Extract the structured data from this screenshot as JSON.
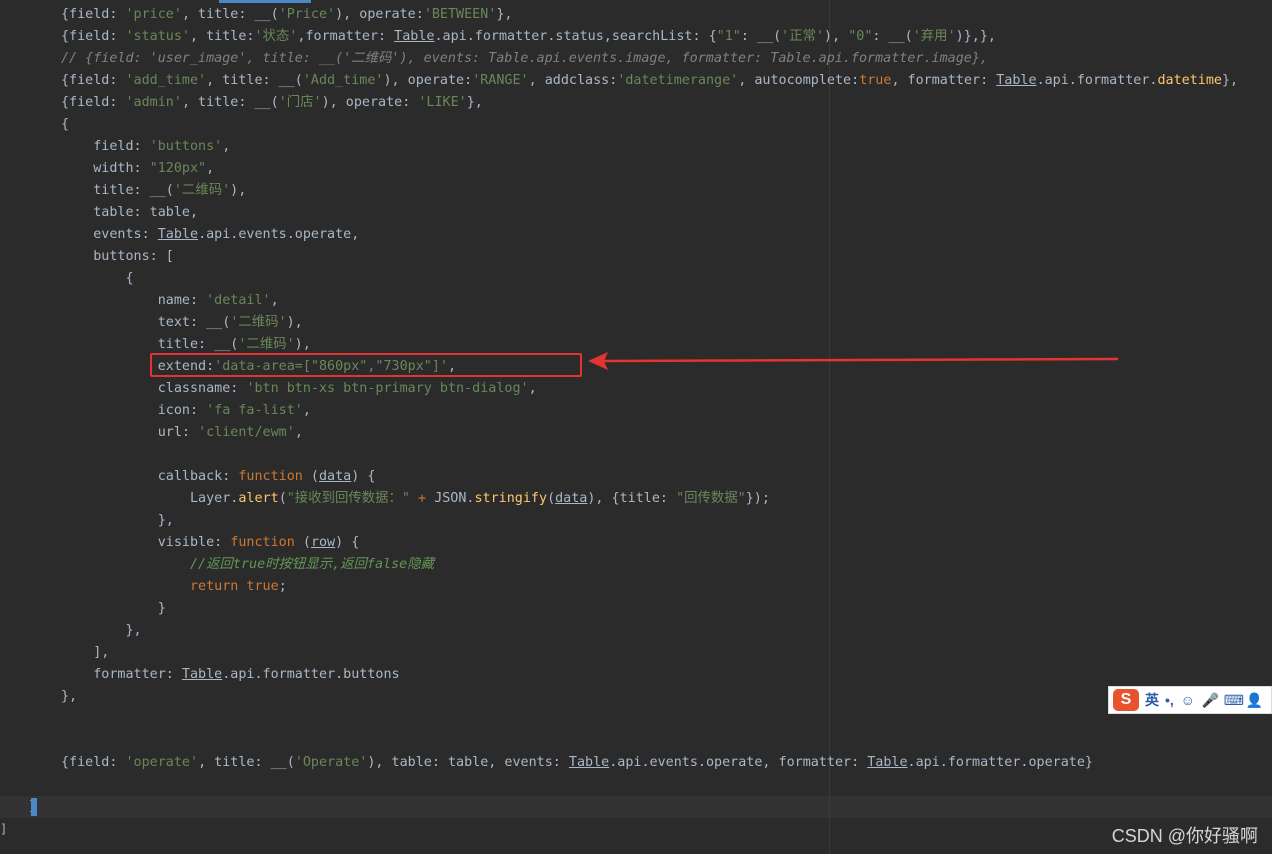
{
  "editor": {
    "lines": [
      [
        {
          "t": "{field: ",
          "c": "p0"
        },
        {
          "t": "'price'",
          "c": "s"
        },
        {
          "t": ", title: __(",
          "c": "p0"
        },
        {
          "t": "'Price'",
          "c": "s"
        },
        {
          "t": "), operate:",
          "c": "p0"
        },
        {
          "t": "'BETWEEN'",
          "c": "s"
        },
        {
          "t": "},",
          "c": "p0"
        }
      ],
      [
        {
          "t": "{field: ",
          "c": "p0"
        },
        {
          "t": "'status'",
          "c": "s"
        },
        {
          "t": ", title:",
          "c": "p0"
        },
        {
          "t": "'状态'",
          "c": "s"
        },
        {
          "t": ",formatter: ",
          "c": "p0"
        },
        {
          "t": "Table",
          "c": "u"
        },
        {
          "t": ".api.formatter.status,searchList: {",
          "c": "p0"
        },
        {
          "t": "\"1\"",
          "c": "s"
        },
        {
          "t": ": __(",
          "c": "p0"
        },
        {
          "t": "'正常'",
          "c": "s"
        },
        {
          "t": "), ",
          "c": "p0"
        },
        {
          "t": "\"0\"",
          "c": "s"
        },
        {
          "t": ": __(",
          "c": "p0"
        },
        {
          "t": "'弃用'",
          "c": "s"
        },
        {
          "t": ")},},",
          "c": "p0"
        }
      ],
      [
        {
          "t": "// {field: 'user_image', title: __('二维码'), events: Table.api.events.image, formatter: Table.api.formatter.image},",
          "c": "cm"
        }
      ],
      [
        {
          "t": "{field: ",
          "c": "p0"
        },
        {
          "t": "'add_time'",
          "c": "s"
        },
        {
          "t": ", title: __(",
          "c": "p0"
        },
        {
          "t": "'Add_time'",
          "c": "s"
        },
        {
          "t": "), operate:",
          "c": "p0"
        },
        {
          "t": "'RANGE'",
          "c": "s"
        },
        {
          "t": ", addclass:",
          "c": "p0"
        },
        {
          "t": "'datetimerange'",
          "c": "s"
        },
        {
          "t": ", autocomplete:",
          "c": "p0"
        },
        {
          "t": "true",
          "c": "k"
        },
        {
          "t": ", formatter: ",
          "c": "p0"
        },
        {
          "t": "Table",
          "c": "u"
        },
        {
          "t": ".api.formatter.",
          "c": "p0"
        },
        {
          "t": "datetime",
          "c": "f"
        },
        {
          "t": "},",
          "c": "p0"
        }
      ],
      [
        {
          "t": "{field: ",
          "c": "p0"
        },
        {
          "t": "'admin'",
          "c": "s"
        },
        {
          "t": ", title: __(",
          "c": "p0"
        },
        {
          "t": "'门店'",
          "c": "s"
        },
        {
          "t": "), operate: ",
          "c": "p0"
        },
        {
          "t": "'LIKE'",
          "c": "s"
        },
        {
          "t": "},",
          "c": "p0"
        }
      ],
      [
        {
          "t": "{",
          "c": "p0"
        }
      ],
      [
        {
          "t": "    field: ",
          "c": "p0"
        },
        {
          "t": "'buttons'",
          "c": "s"
        },
        {
          "t": ",",
          "c": "p0"
        }
      ],
      [
        {
          "t": "    width: ",
          "c": "p0"
        },
        {
          "t": "\"120px\"",
          "c": "s"
        },
        {
          "t": ",",
          "c": "p0"
        }
      ],
      [
        {
          "t": "    title: __(",
          "c": "p0"
        },
        {
          "t": "'二维码'",
          "c": "s"
        },
        {
          "t": "),",
          "c": "p0"
        }
      ],
      [
        {
          "t": "    table: table,",
          "c": "p0"
        }
      ],
      [
        {
          "t": "    events: ",
          "c": "p0"
        },
        {
          "t": "Table",
          "c": "u"
        },
        {
          "t": ".api.events.operate,",
          "c": "p0"
        }
      ],
      [
        {
          "t": "    buttons: [",
          "c": "p0"
        }
      ],
      [
        {
          "t": "        {",
          "c": "p0"
        }
      ],
      [
        {
          "t": "            name: ",
          "c": "p0"
        },
        {
          "t": "'detail'",
          "c": "s"
        },
        {
          "t": ",",
          "c": "p0"
        }
      ],
      [
        {
          "t": "            text: __(",
          "c": "p0"
        },
        {
          "t": "'二维码'",
          "c": "s"
        },
        {
          "t": "),",
          "c": "p0"
        }
      ],
      [
        {
          "t": "            title: __(",
          "c": "p0"
        },
        {
          "t": "'二维码'",
          "c": "s"
        },
        {
          "t": "),",
          "c": "p0"
        }
      ],
      [
        {
          "t": "            extend:",
          "c": "p0"
        },
        {
          "t": "'data-area=[\"860px\",\"730px\"]'",
          "c": "s"
        },
        {
          "t": ",",
          "c": "p0"
        }
      ],
      [
        {
          "t": "            classname: ",
          "c": "p0"
        },
        {
          "t": "'btn btn-xs btn-primary btn-dialog'",
          "c": "s"
        },
        {
          "t": ",",
          "c": "p0"
        }
      ],
      [
        {
          "t": "            icon: ",
          "c": "p0"
        },
        {
          "t": "'fa fa-list'",
          "c": "s"
        },
        {
          "t": ",",
          "c": "p0"
        }
      ],
      [
        {
          "t": "            url: ",
          "c": "p0"
        },
        {
          "t": "'client/ewm'",
          "c": "s"
        },
        {
          "t": ",",
          "c": "p0"
        }
      ],
      [
        {
          "t": "",
          "c": "p0"
        }
      ],
      [
        {
          "t": "            callback: ",
          "c": "p0"
        },
        {
          "t": "function",
          "c": "k"
        },
        {
          "t": " (",
          "c": "p0"
        },
        {
          "t": "data",
          "c": "u"
        },
        {
          "t": ") {",
          "c": "p0"
        }
      ],
      [
        {
          "t": "                Layer.",
          "c": "p0"
        },
        {
          "t": "alert",
          "c": "f"
        },
        {
          "t": "(",
          "c": "p0"
        },
        {
          "t": "\"接收到回传数据：\"",
          "c": "s"
        },
        {
          "t": " + ",
          "c": "k"
        },
        {
          "t": "JSON.",
          "c": "p0"
        },
        {
          "t": "stringify",
          "c": "f"
        },
        {
          "t": "(",
          "c": "p0"
        },
        {
          "t": "data",
          "c": "u"
        },
        {
          "t": "), {title: ",
          "c": "p0"
        },
        {
          "t": "\"回传数据\"",
          "c": "s"
        },
        {
          "t": "});",
          "c": "p0"
        }
      ],
      [
        {
          "t": "            },",
          "c": "p0"
        }
      ],
      [
        {
          "t": "            visible: ",
          "c": "p0"
        },
        {
          "t": "function",
          "c": "k"
        },
        {
          "t": " (",
          "c": "p0"
        },
        {
          "t": "row",
          "c": "u"
        },
        {
          "t": ") {",
          "c": "p0"
        }
      ],
      [
        {
          "t": "                //返回true时按钮显示,返回false隐藏",
          "c": "c"
        }
      ],
      [
        {
          "t": "                ",
          "c": "p0"
        },
        {
          "t": "return true",
          "c": "k"
        },
        {
          "t": ";",
          "c": "p0"
        }
      ],
      [
        {
          "t": "            }",
          "c": "p0"
        }
      ],
      [
        {
          "t": "        },",
          "c": "p0"
        }
      ],
      [
        {
          "t": "    ],",
          "c": "p0"
        }
      ],
      [
        {
          "t": "    formatter: ",
          "c": "p0"
        },
        {
          "t": "Table",
          "c": "u"
        },
        {
          "t": ".api.formatter.buttons",
          "c": "p0"
        }
      ],
      [
        {
          "t": "},",
          "c": "p0"
        }
      ],
      [
        {
          "t": "",
          "c": "p0"
        }
      ],
      [
        {
          "t": "",
          "c": "p0"
        }
      ],
      [
        {
          "t": "{field: ",
          "c": "p0"
        },
        {
          "t": "'operate'",
          "c": "s"
        },
        {
          "t": ", title: __(",
          "c": "p0"
        },
        {
          "t": "'Operate'",
          "c": "s"
        },
        {
          "t": "), table: table, events: ",
          "c": "p0"
        },
        {
          "t": "Table",
          "c": "u"
        },
        {
          "t": ".api.events.operate, formatter: ",
          "c": "p0"
        },
        {
          "t": "Table",
          "c": "u"
        },
        {
          "t": ".api.formatter.operate}",
          "c": "p0"
        }
      ],
      [
        {
          "t": "",
          "c": "p0"
        }
      ],
      [
        {
          "t": "]",
          "c": "p0"
        }
      ]
    ]
  },
  "gutter_bracket": "]",
  "ime": {
    "logo": "S",
    "mode": "英",
    "punct": "•,",
    "icons": [
      "smile-icon",
      "mic-icon",
      "keyboard-icon",
      "user-icon"
    ]
  },
  "watermark": "CSDN @你好骚啊",
  "colors": {
    "background": "#2b2b2b",
    "highlight": "#e53232",
    "string": "#6a8759",
    "keyword": "#cc7832"
  }
}
